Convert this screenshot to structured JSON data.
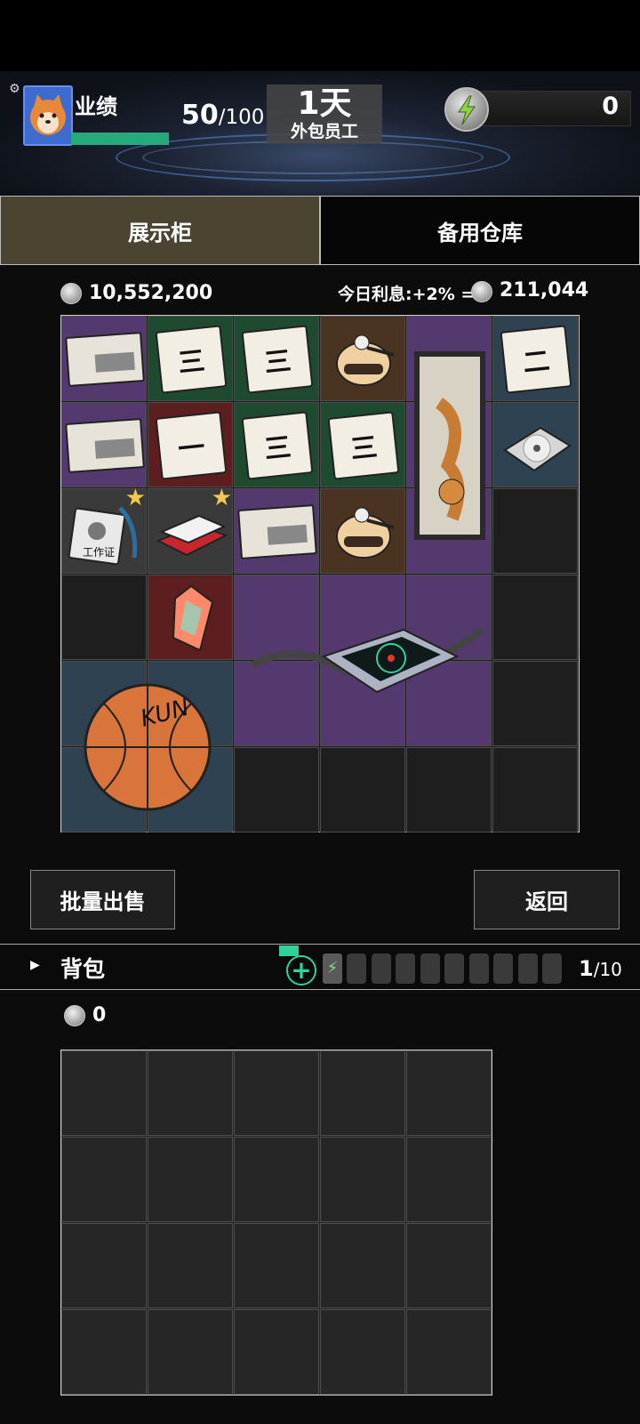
{
  "hud": {
    "performance_label": "业绩",
    "performance_current": "50",
    "performance_max": "/100",
    "performance_fraction": 0.5,
    "day_value": "1天",
    "day_subtitle": "外包员工",
    "energy_value": "0"
  },
  "tabs": [
    {
      "label": "展示柜",
      "active": true
    },
    {
      "label": "备用仓库",
      "active": false
    }
  ],
  "money": {
    "balance": "10,552,200",
    "interest_label": "今日利息:+2% =",
    "interest_value": "211,044"
  },
  "display_items": {
    "items": [
      {
        "name": "item-ticket-card",
        "star": false
      },
      {
        "name": "item-card-three",
        "glyph": "三",
        "star": false
      },
      {
        "name": "item-card-three",
        "glyph": "三",
        "star": false
      },
      {
        "name": "item-beetle-gadget",
        "star": false
      },
      {
        "name": "item-tiger-scroll",
        "star": false
      },
      {
        "name": "item-card-two",
        "glyph": "二",
        "star": false
      },
      {
        "name": "item-ticket-card",
        "star": false
      },
      {
        "name": "item-card-one",
        "glyph": "一",
        "star": false
      },
      {
        "name": "item-card-three",
        "glyph": "三",
        "star": false
      },
      {
        "name": "item-card-three",
        "glyph": "三",
        "star": false
      },
      {
        "name": "item-disc",
        "star": false
      },
      {
        "name": "item-id-badge",
        "badge_text": "工作证",
        "star": true
      },
      {
        "name": "item-cigarette-pack",
        "star": true
      },
      {
        "name": "item-ticket-card",
        "star": false
      },
      {
        "name": "item-beetle-gadget",
        "star": false
      },
      {
        "name": "item-crystal",
        "star": false
      },
      {
        "name": "item-radar-device",
        "star": false
      },
      {
        "name": "item-basketball",
        "ball_text": "KUN",
        "star": false
      }
    ]
  },
  "buttons": {
    "sell_all": "批量出售",
    "back": "返回"
  },
  "backpack": {
    "label": "背包",
    "count_current": "1",
    "count_max": "/10",
    "money": "0"
  },
  "colors": {
    "cell_purple": "#54396f",
    "cell_green": "#1e4a30",
    "cell_brown": "#4a3320",
    "cell_red": "#5c1e1e",
    "cell_slate": "#2f4252",
    "cell_gray": "#3a3a3a",
    "tab_active": "#4b4430",
    "accent_green": "#2fd29a"
  }
}
